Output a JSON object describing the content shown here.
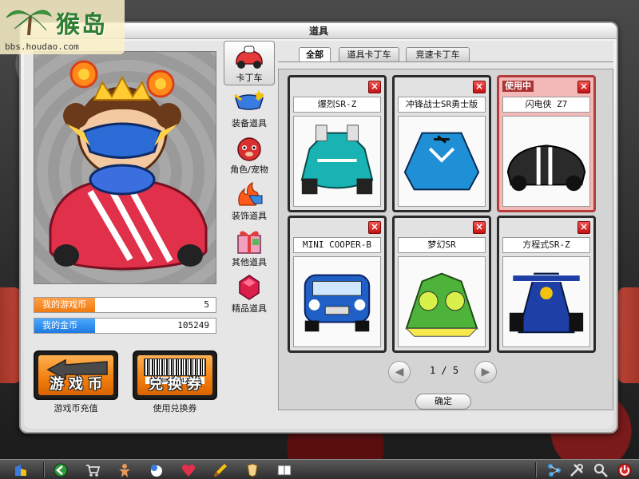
{
  "watermark": {
    "brand": "猴岛",
    "url": "bbs.houdao.com"
  },
  "dialog": {
    "title": "道具"
  },
  "stats": {
    "game_coin_label": "我的游戏币",
    "game_coin_value": "5",
    "gold_label": "我的金币",
    "gold_value": "105249"
  },
  "buttons": {
    "game_coin_text": "游戏币",
    "game_coin_caption": "游戏币充值",
    "coupon_text": "兑换券",
    "coupon_caption": "使用兑换券",
    "coupon_barcode": "B 0K5B74266",
    "ok": "确定"
  },
  "categories": [
    {
      "label": "卡丁车",
      "icon": "kart-icon",
      "active": true
    },
    {
      "label": "装备道具",
      "icon": "goggles-icon",
      "active": false
    },
    {
      "label": "角色/宠物",
      "icon": "pet-icon",
      "active": false
    },
    {
      "label": "装饰道具",
      "icon": "decoration-icon",
      "active": false
    },
    {
      "label": "其他道具",
      "icon": "gift-box-icon",
      "active": false
    },
    {
      "label": "精品道具",
      "icon": "gem-icon",
      "active": false
    }
  ],
  "tabs": [
    {
      "label": "全部",
      "active": true
    },
    {
      "label": "道具卡丁车",
      "active": false
    },
    {
      "label": "竞速卡丁车",
      "active": false
    }
  ],
  "items": [
    {
      "name": "爆烈SR-Z",
      "status": "",
      "color": "#19b3b3"
    },
    {
      "name": "冲锋战士SR勇士版",
      "status": "",
      "color": "#1f8fd6"
    },
    {
      "name": "闪电侠 Z7",
      "status": "使用中",
      "color": "#2a2a2a"
    },
    {
      "name": "MINI COOPER-B",
      "status": "",
      "color": "#1f5fc6"
    },
    {
      "name": "梦幻SR",
      "status": "",
      "color": "#4db33a"
    },
    {
      "name": "方程式SR-Z",
      "status": "",
      "color": "#1d3fa6"
    }
  ],
  "pager": {
    "text": "1 / 5",
    "prev_icon": "arrow-left-icon",
    "next_icon": "arrow-right-icon"
  },
  "colors": {
    "coin_orange": "#f07a10",
    "gold_blue": "#1f7ae0",
    "in_use_red": "#b43b3b",
    "close_red": "#c41212"
  },
  "taskbar": {
    "icons": [
      "start-icon",
      "back-icon",
      "shop-cart-icon",
      "character-icon",
      "chat-icon",
      "heart-icon",
      "brush-icon",
      "badge-icon",
      "book-icon",
      "network-icon",
      "tools-icon",
      "search-icon",
      "power-icon"
    ]
  }
}
